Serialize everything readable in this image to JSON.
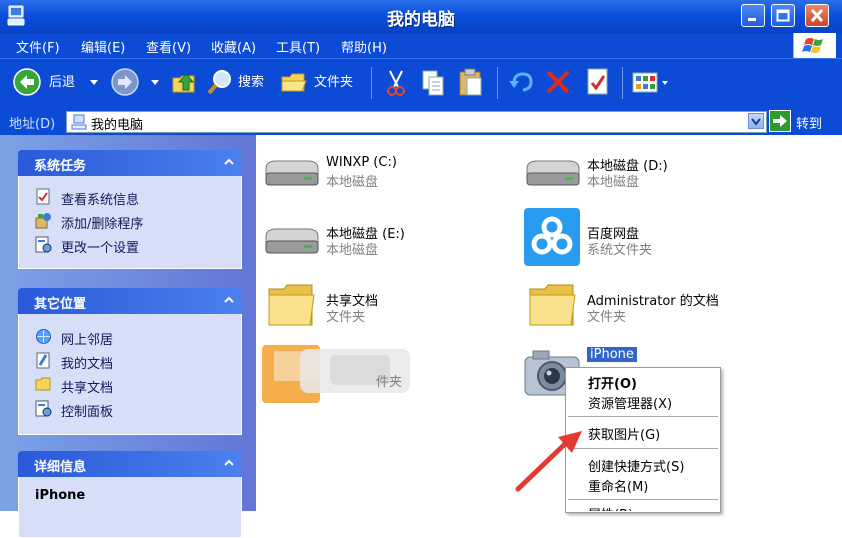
{
  "window": {
    "title": "我的电脑"
  },
  "menubar": {
    "items": [
      "文件(F)",
      "编辑(E)",
      "查看(V)",
      "收藏(A)",
      "工具(T)",
      "帮助(H)"
    ]
  },
  "toolbar": {
    "back_label": "后退",
    "search_label": "搜索",
    "folders_label": "文件夹"
  },
  "address": {
    "label": "地址(D)",
    "value": "我的电脑",
    "go_label": "转到"
  },
  "tasks_panel": {
    "title": "系统任务",
    "items": [
      {
        "label": "查看系统信息",
        "icon": "system-info-icon"
      },
      {
        "label": "添加/删除程序",
        "icon": "add-remove-icon"
      },
      {
        "label": "更改一个设置",
        "icon": "control-settings-icon"
      }
    ]
  },
  "places_panel": {
    "title": "其它位置",
    "items": [
      {
        "label": "网上邻居",
        "icon": "network-icon"
      },
      {
        "label": "我的文档",
        "icon": "my-documents-icon"
      },
      {
        "label": "共享文档",
        "icon": "shared-folder-icon"
      },
      {
        "label": "控制面板",
        "icon": "control-panel-icon"
      }
    ]
  },
  "details_panel": {
    "title": "详细信息",
    "name": "iPhone"
  },
  "items": [
    {
      "name": "WINXP (C:)",
      "type": "本地磁盘",
      "icon": "hard-drive-icon"
    },
    {
      "name": "本地磁盘 (D:)",
      "type": "本地磁盘",
      "icon": "hard-drive-icon"
    },
    {
      "name": "本地磁盘 (E:)",
      "type": "本地磁盘",
      "icon": "hard-drive-icon"
    },
    {
      "name": "百度网盘",
      "type": "系统文件夹",
      "icon": "baidu-cloud-icon"
    },
    {
      "name": "共享文档",
      "type": "文件夹",
      "icon": "folder-icon"
    },
    {
      "name": "Administrator 的文档",
      "type": "文件夹",
      "icon": "folder-icon"
    },
    {
      "name": "",
      "type": "件夹",
      "icon": "blurred-folder-icon"
    },
    {
      "name": "iPhone",
      "type": "",
      "icon": "camera-icon"
    }
  ],
  "context_menu": {
    "items": [
      "打开(O)",
      "资源管理器(X)",
      "获取图片(G)",
      "创建快捷方式(S)",
      "重命名(M)",
      "属性(R)"
    ]
  },
  "colors": {
    "title_blue": "#0a4fdc",
    "panel_bg": "#d6dff7",
    "pane_bg": "#7ba2e7",
    "arrow_red": "#e53935"
  }
}
